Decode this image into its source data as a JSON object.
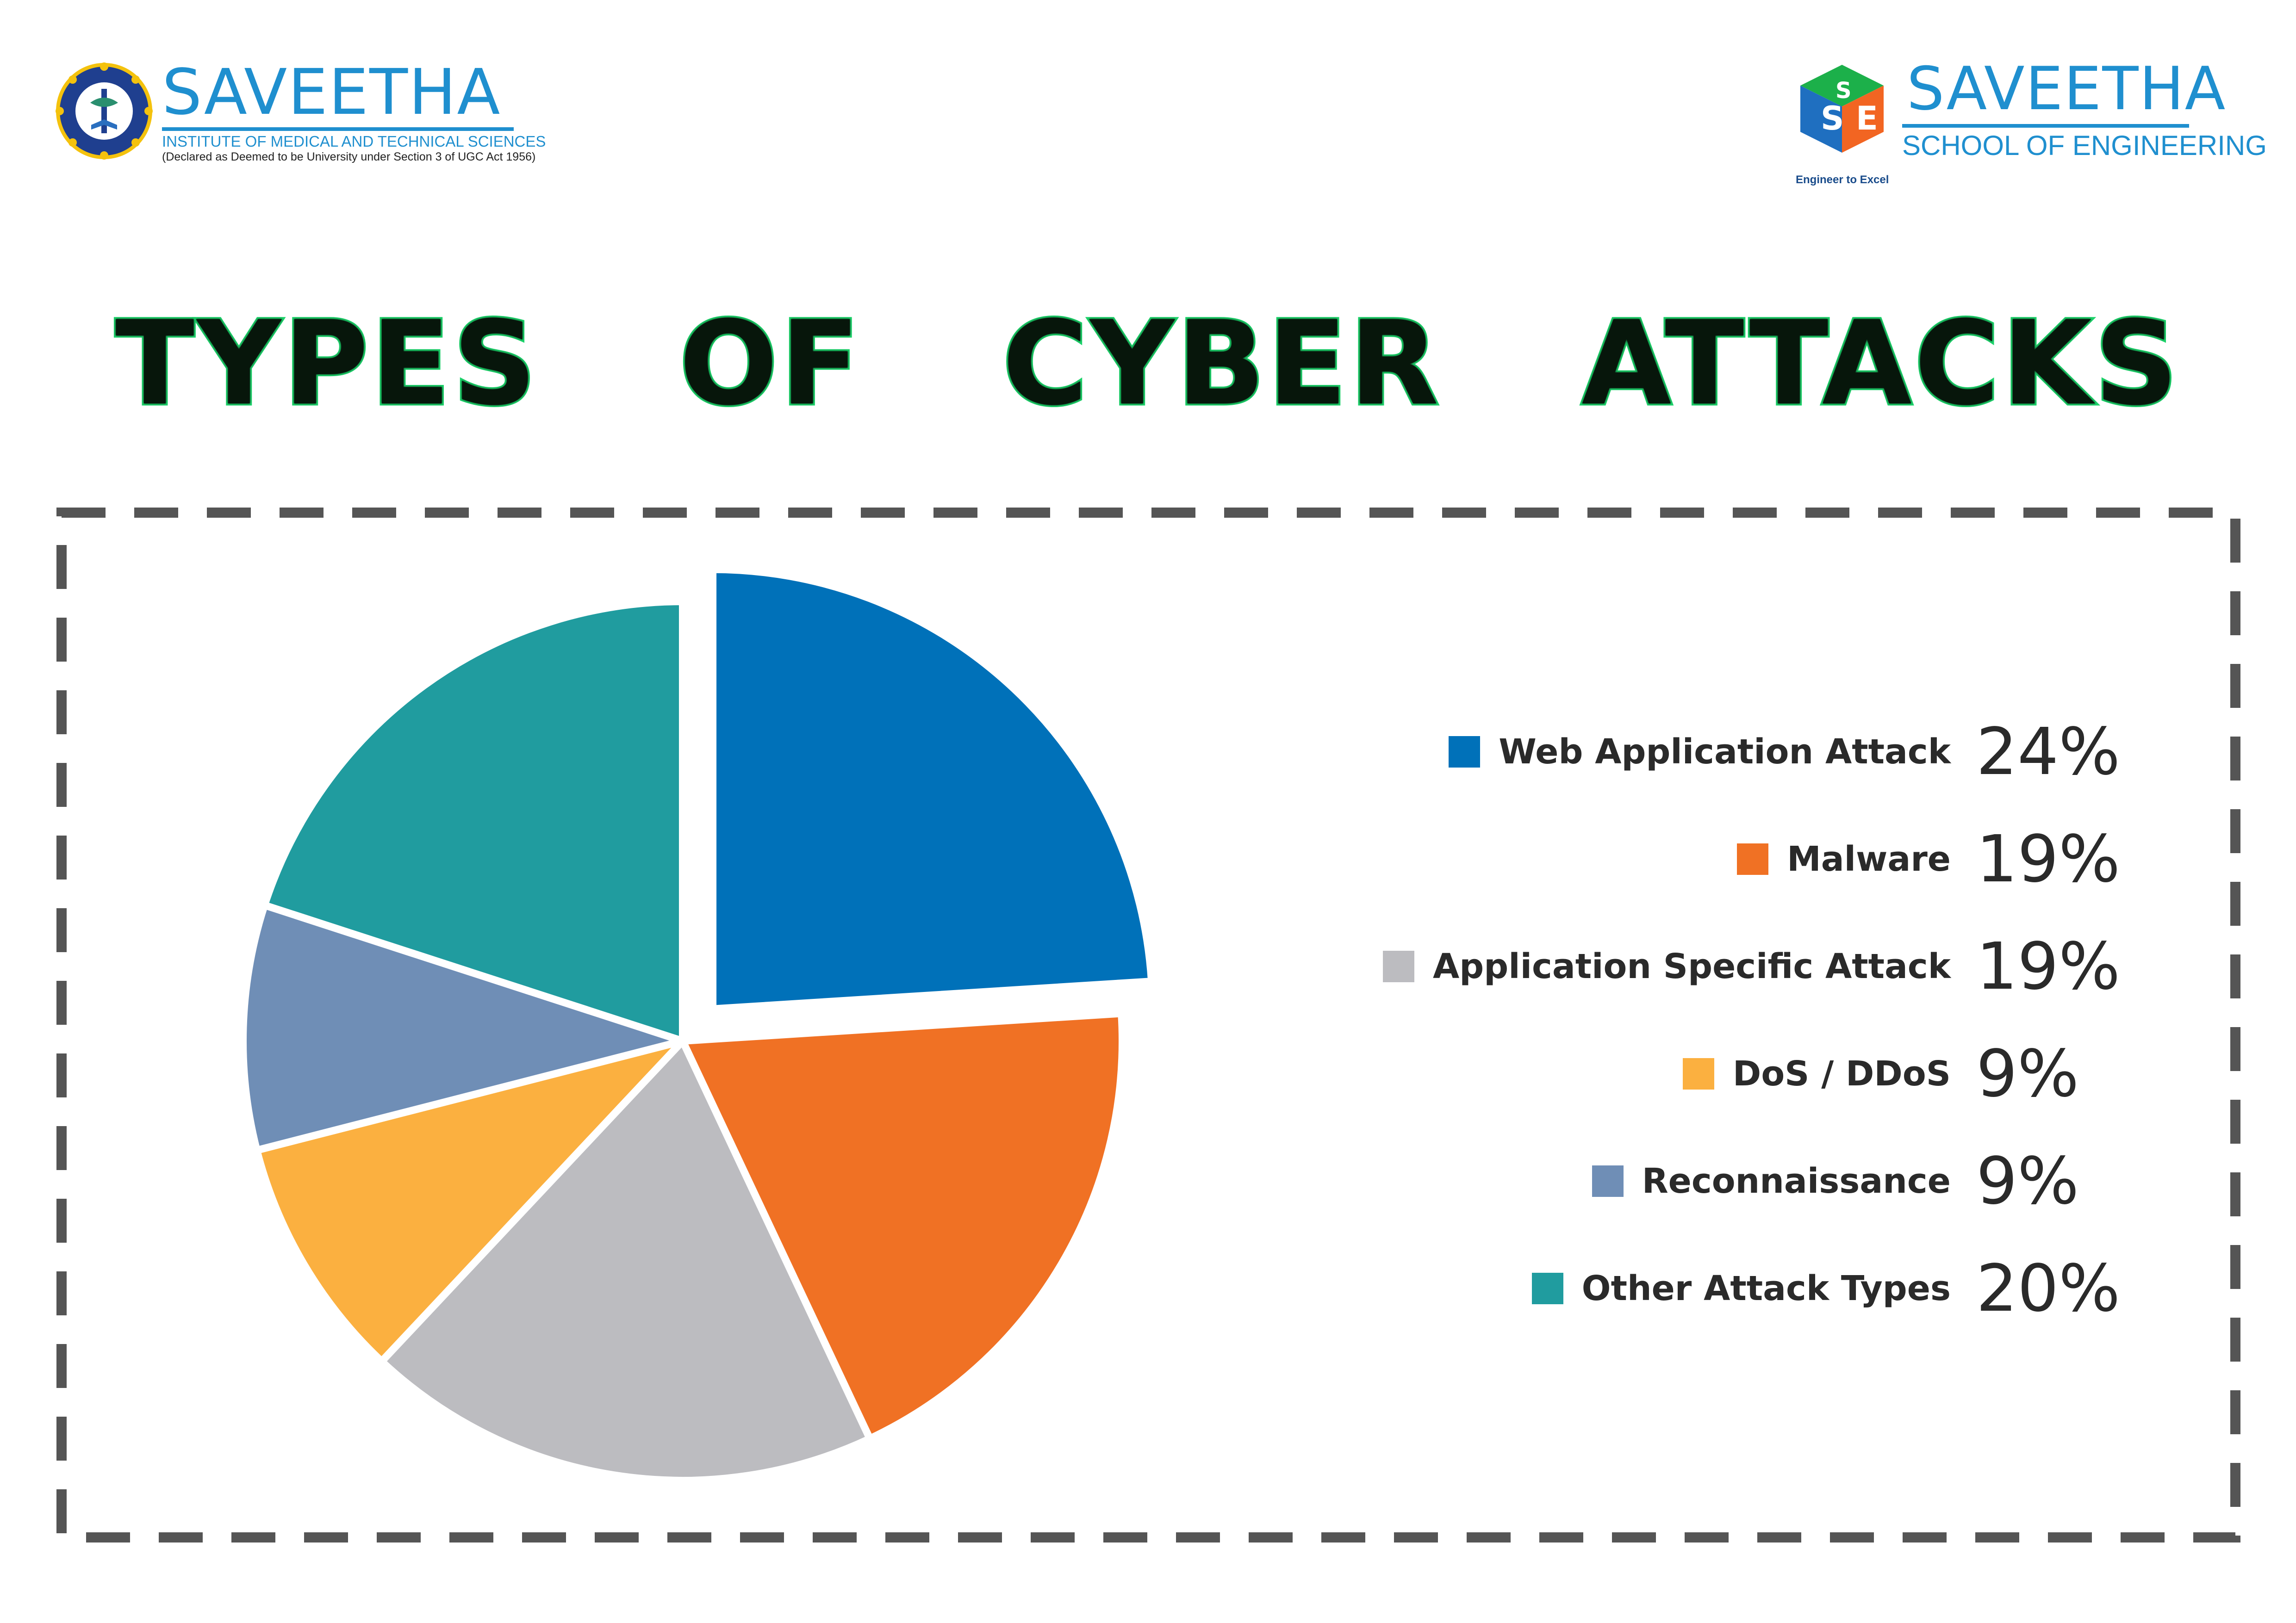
{
  "header": {
    "left_logo": {
      "name": "SAVEETHA",
      "subtitle": "INSTITUTE OF MEDICAL AND TECHNICAL SCIENCES",
      "note": "(Declared as Deemed to be University under Section 3 of UGC Act 1956)"
    },
    "right_logo": {
      "name": "SAVEETHA",
      "subtitle": "SCHOOL OF ENGINEERING",
      "tagline": "Engineer to Excel"
    }
  },
  "title": "TYPES OF CYBER ATTACKS",
  "chart_data": {
    "type": "pie",
    "title": "TYPES OF CYBER ATTACKS",
    "exploded_slice": "Web Application Attack",
    "legend_position": "right",
    "slices": [
      {
        "label": "Web Application Attack",
        "value": 24,
        "display": "24%",
        "color": "#0071b9"
      },
      {
        "label": "Malware",
        "value": 19,
        "display": "19%",
        "color": "#f07124"
      },
      {
        "label": "Application Specific Attack",
        "value": 19,
        "display": "19%",
        "color": "#bcbcc0"
      },
      {
        "label": "DoS / DDoS",
        "value": 9,
        "display": "9%",
        "color": "#fbb040"
      },
      {
        "label": "Reconnaissance",
        "value": 9,
        "display": "9%",
        "color": "#6f8eb6"
      },
      {
        "label": "Other Attack Types",
        "value": 20,
        "display": "20%",
        "color": "#209c9f"
      }
    ]
  },
  "colors": {
    "brand_blue": "#1f8fcf",
    "title_glow": "#1cd36a",
    "frame": "#555555"
  }
}
